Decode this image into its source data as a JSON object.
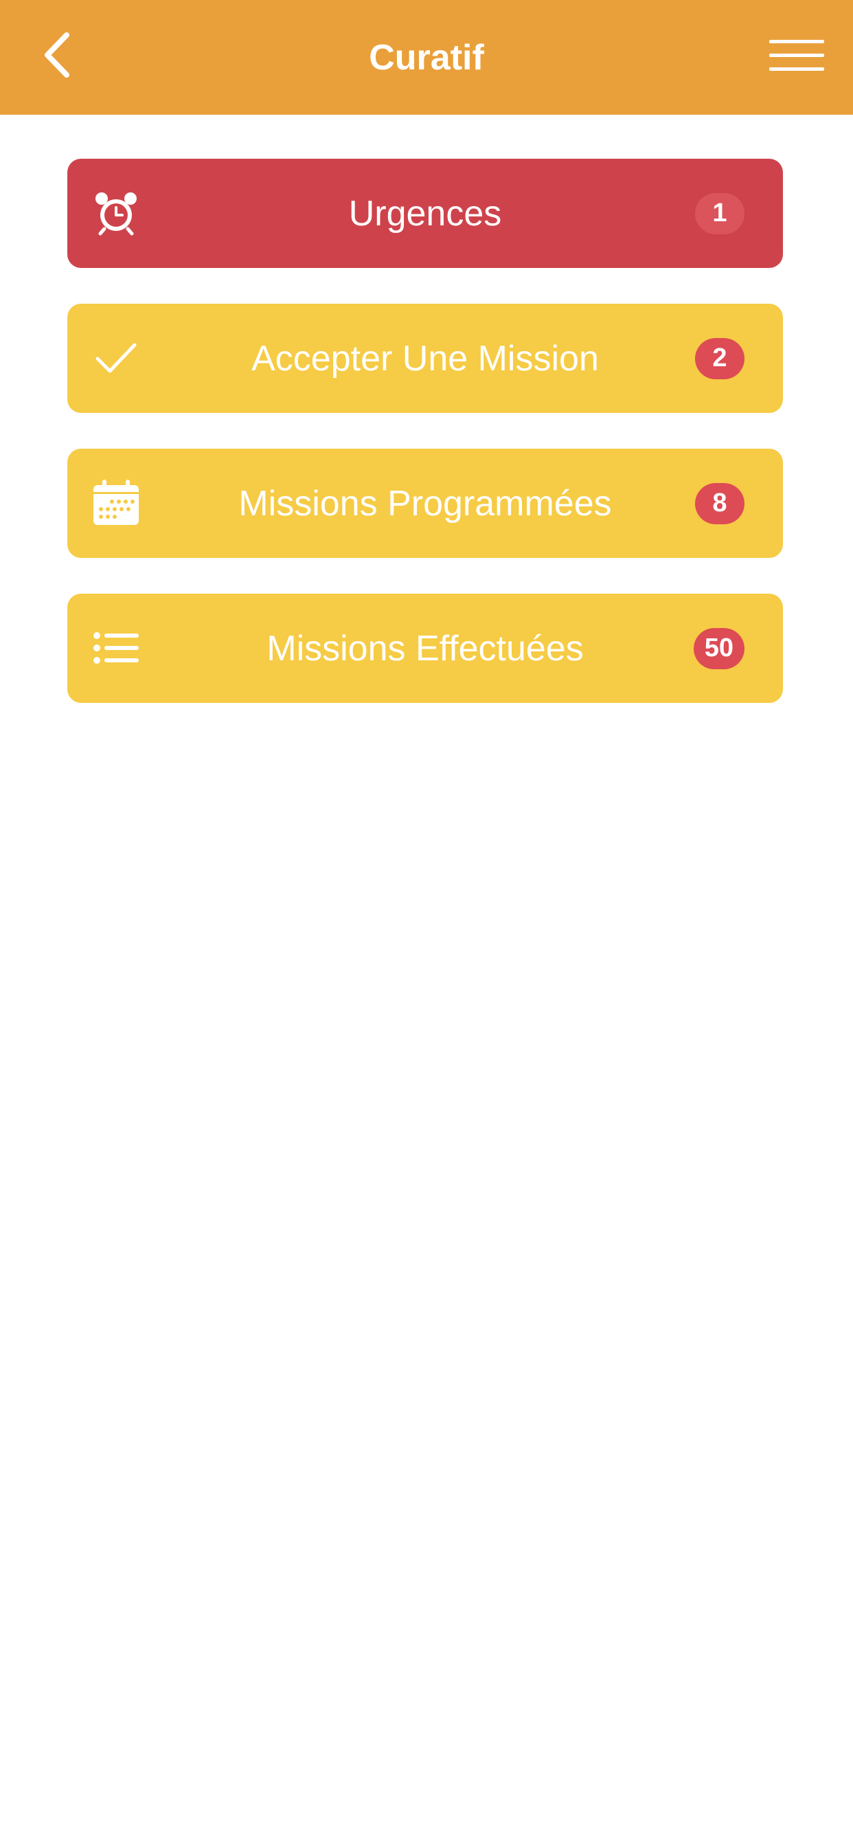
{
  "colors": {
    "header_bg": "#E9A03B",
    "urgent_bg": "#CE434B",
    "item_bg": "#F6CB45",
    "badge_on_urgent": "#DB545C",
    "badge_on_yellow": "#DD4B55"
  },
  "header": {
    "title": "Curatif",
    "back_icon": "chevron-left-icon",
    "menu_icon": "hamburger-menu-icon"
  },
  "items": [
    {
      "label": "Urgences",
      "count": "1",
      "icon": "alarm-clock-icon"
    },
    {
      "label": "Accepter Une Mission",
      "count": "2",
      "icon": "checkmark-icon"
    },
    {
      "label": "Missions Programmées",
      "count": "8",
      "icon": "calendar-icon"
    },
    {
      "label": "Missions Effectuées",
      "count": "50",
      "icon": "list-icon"
    }
  ]
}
